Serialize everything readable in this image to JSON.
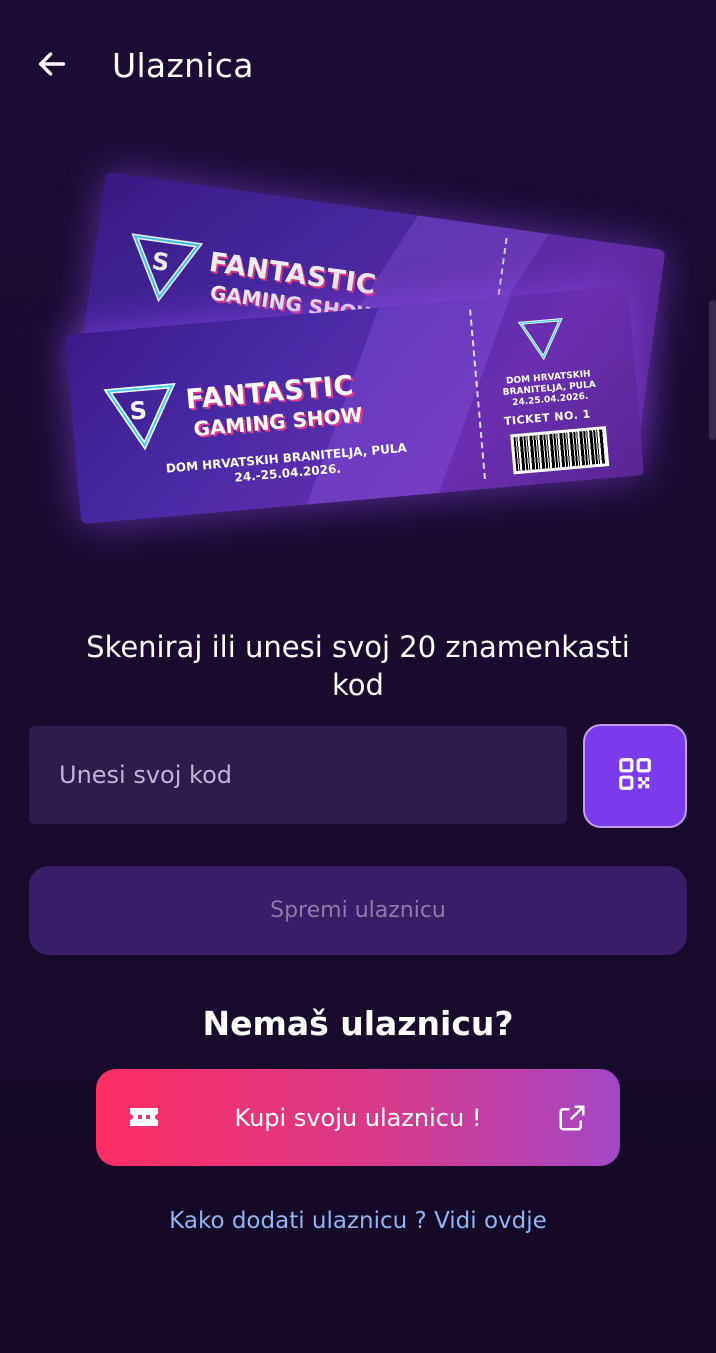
{
  "header": {
    "title": "Ulaznica",
    "back_icon": "arrow-left-icon"
  },
  "ticket_image": {
    "brand_line1": "FANTASTIC",
    "brand_line2": "GAMING SHOW",
    "venue": "DOM HRVATSKIH BRANITELJA, PULA",
    "dates": "24.-25.04.2026.",
    "stub_venue": "DOM HRVATSKIH BRANITELJA, PULA",
    "stub_date": "24.25.04.2026.",
    "ticket_no": "TICKET NO. 1"
  },
  "form": {
    "prompt": "Skeniraj ili unesi svoj 20 znamenkasti kod",
    "code_placeholder": "Unesi svoj kod",
    "scan_icon": "qr-code-icon",
    "save_label": "Spremi ulaznicu"
  },
  "buy": {
    "heading": "Nemaš ulaznicu?",
    "button_label": "Kupi svoju ulaznicu !",
    "ticket_icon": "ticket-icon",
    "external_icon": "external-link-icon"
  },
  "help": {
    "link_text": "Kako dodati ulaznicu ? Vidi ovdje"
  },
  "colors": {
    "background": "#1c0c35",
    "accent": "#7c3aed",
    "save_bg": "#3a1d68",
    "buy_gradient_start": "#ff2d64",
    "buy_gradient_end": "#a447c6",
    "link": "#8fb6f2"
  }
}
